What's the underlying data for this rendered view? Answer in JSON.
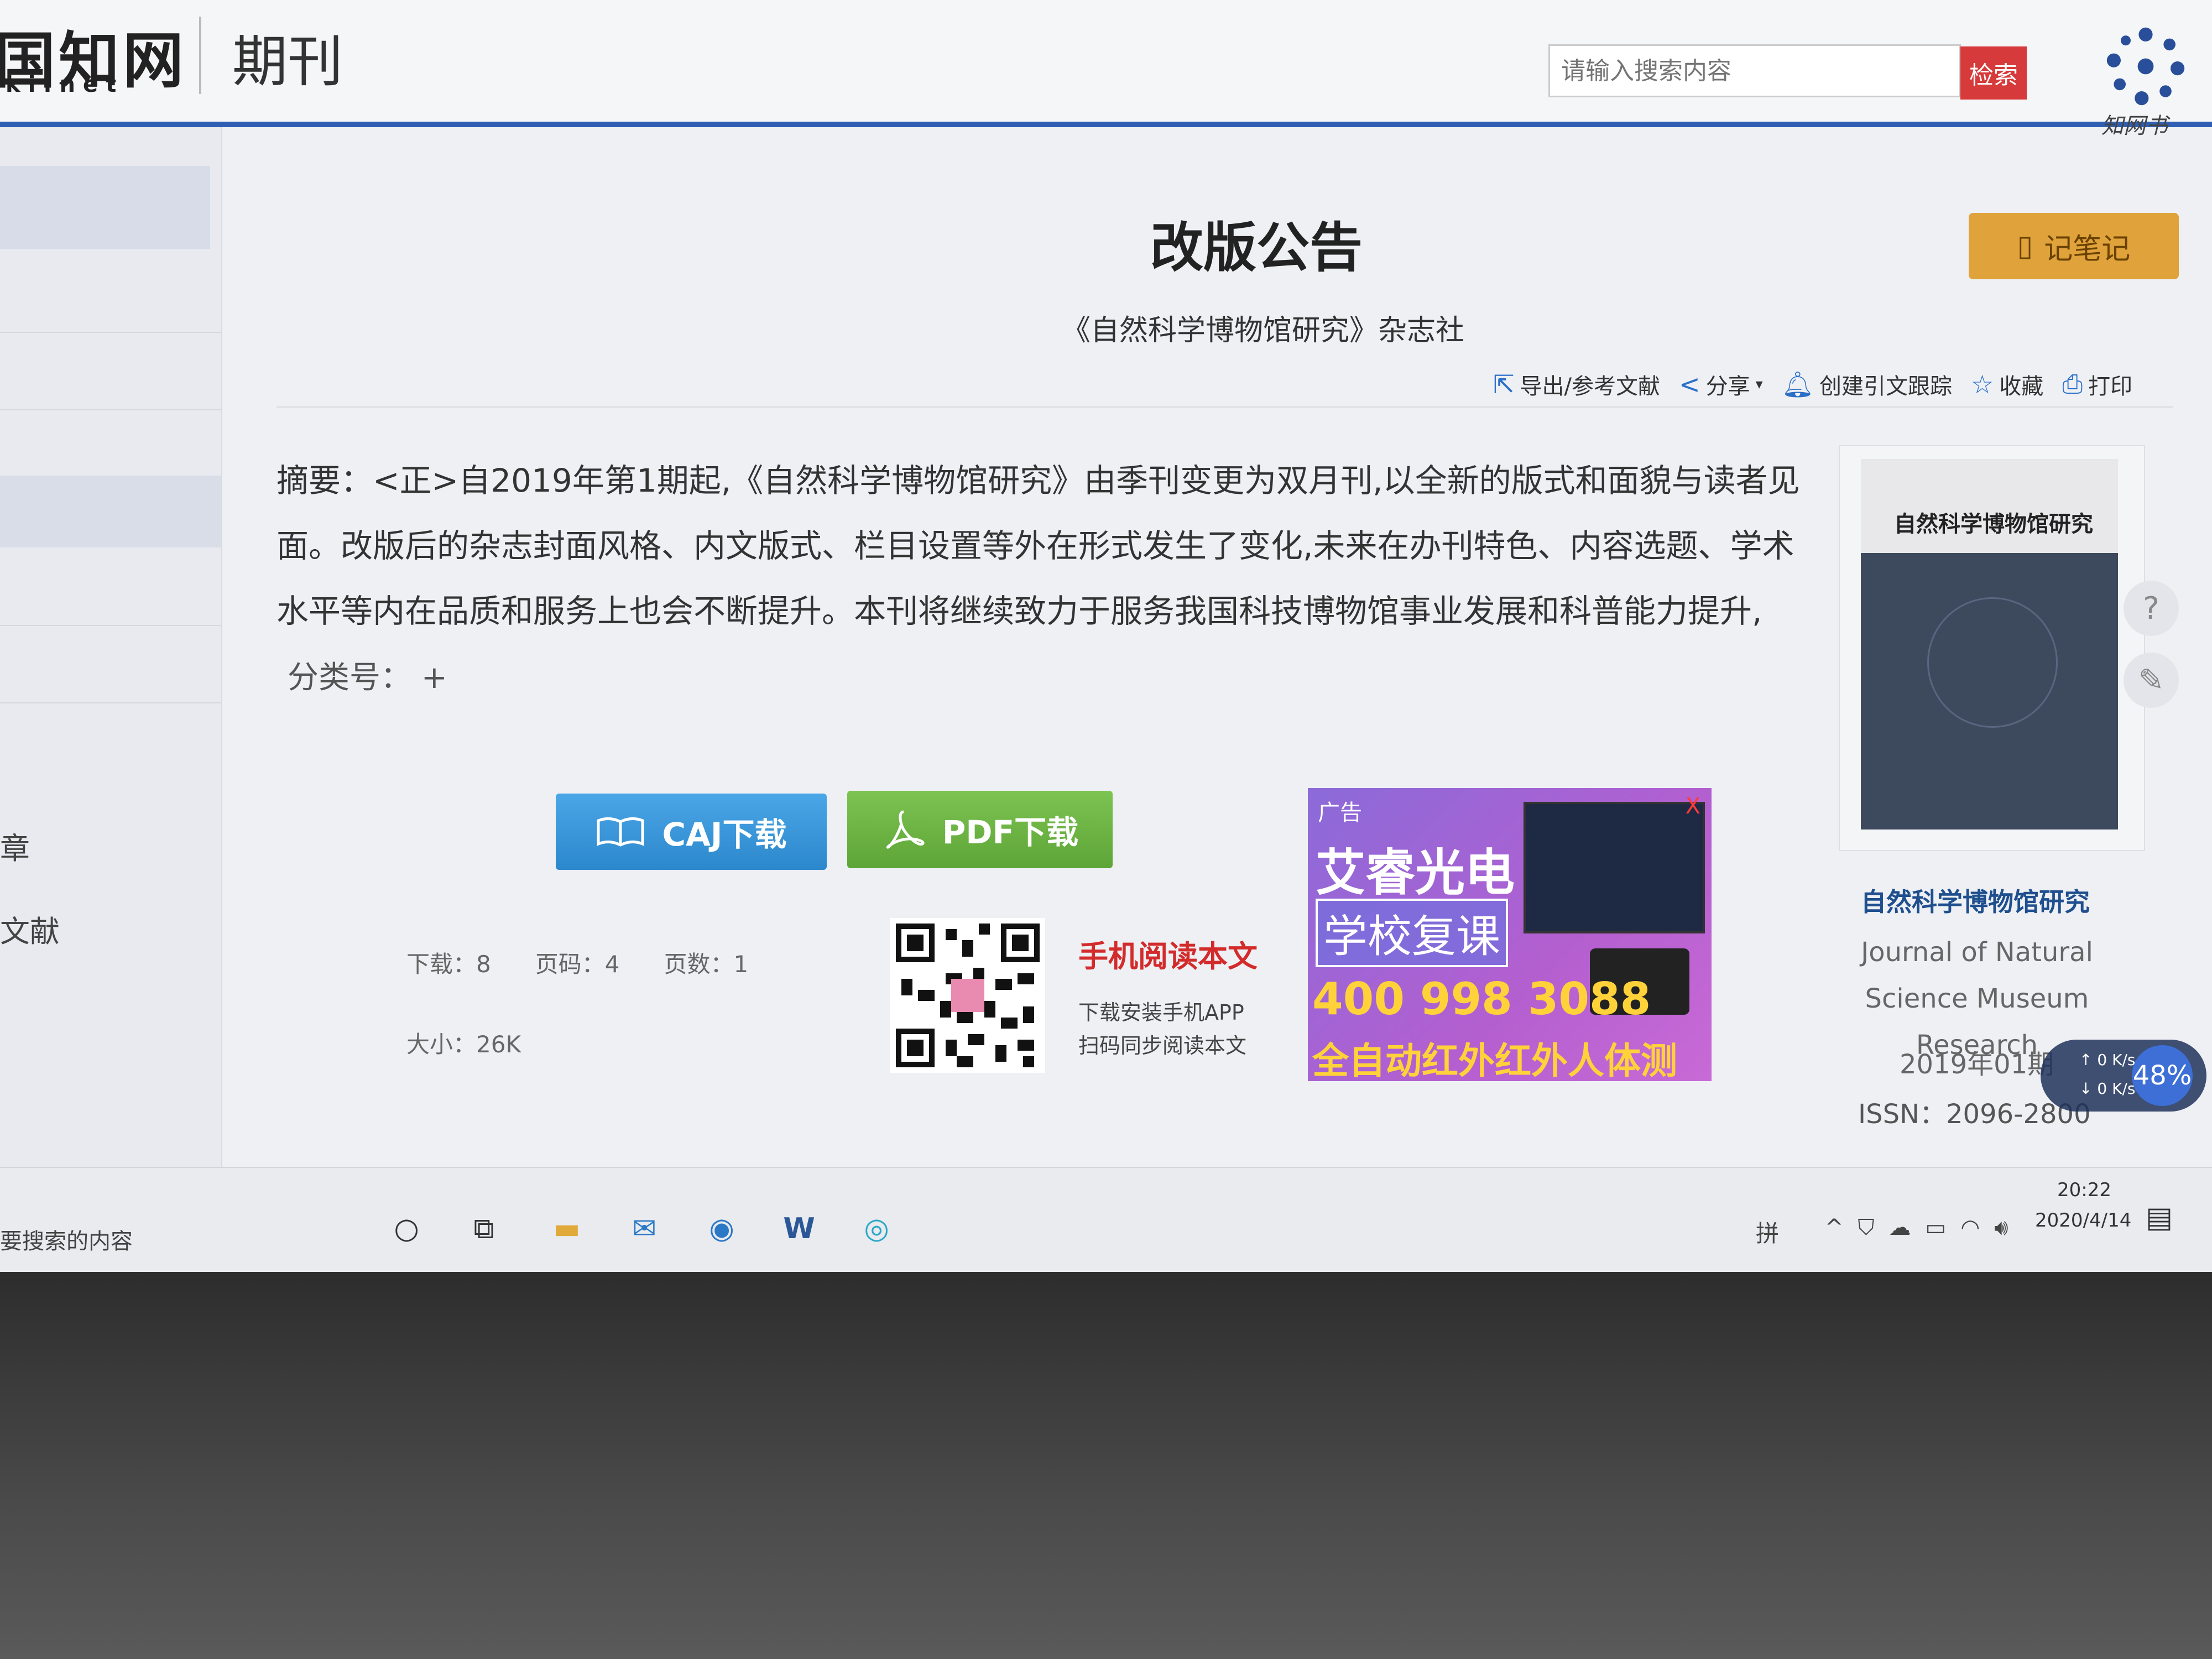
{
  "header": {
    "logo_cn": "国知网",
    "logo_net": "ki.net",
    "nav_title": "期刊",
    "search_placeholder": "请输入搜索内容",
    "search_button": "检索",
    "app_logo_text": "知网书"
  },
  "sidebar": {
    "partial_items": [
      "章",
      "文献"
    ]
  },
  "article": {
    "title": "改版公告",
    "publisher": "《自然科学博物馆研究》杂志社",
    "notes_button": "记笔记",
    "toolbar": [
      {
        "label": "导出/参考文献",
        "icon": "export-icon"
      },
      {
        "label": "分享",
        "icon": "share-icon"
      },
      {
        "label": "创建引文跟踪",
        "icon": "bell-icon"
      },
      {
        "label": "收藏",
        "icon": "star-icon"
      },
      {
        "label": "打印",
        "icon": "print-icon"
      }
    ],
    "abstract_label": "摘要：",
    "abstract_text": "<正>自2019年第1期起,《自然科学博物馆研究》由季刊变更为双月刊,以全新的版式和面貌与读者见面。改版后的杂志封面风格、内文版式、栏目设置等外在形式发生了变化,未来在办刊特色、内容选题、学术水平等内在品质和服务上也会不断提升。本刊将继续致力于服务我国科技博物馆事业发展和科普能力提升,",
    "class_label": "分类号：",
    "class_value": "+"
  },
  "downloads": {
    "caj_label": "CAJ下载",
    "pdf_label": "PDF下载",
    "downloads_label": "下载：",
    "downloads_value": "8",
    "page_label": "页码：",
    "page_value": "4",
    "pages_label": "页数：",
    "pages_value": "1",
    "size_label": "大小：",
    "size_value": "26K"
  },
  "mobile": {
    "title": "手机阅读本文",
    "line1": "下载安装手机APP",
    "line2": "扫码同步阅读本文"
  },
  "ad": {
    "tag": "广告",
    "close": "X",
    "brand": "艾睿光电",
    "sub": "学校复课",
    "phone": "400 998 3088",
    "slogan": "全自动红外红外人体测温仪"
  },
  "journal": {
    "cover_title": "自然科学博物馆研究",
    "name_cn": "自然科学博物馆研究",
    "name_en": "Journal of Natural Science Museum Research",
    "issue": "2019年01期",
    "issn": "ISSN：2096-2800"
  },
  "net_widget": {
    "up": "0 K/s",
    "down": "0 K/s",
    "percent": "48%"
  },
  "taskbar": {
    "search_hint": "要搜索的内容",
    "ime": "拼",
    "time": "20:22",
    "date": "2020/4/14"
  }
}
